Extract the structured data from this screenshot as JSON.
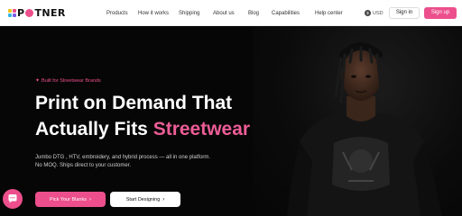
{
  "brand": {
    "logo_prefix": "P",
    "logo_suffix": "TNER",
    "logo_colors": [
      "#f0c21a",
      "#ec4f8c",
      "#37b6e6",
      "#7c5ce6"
    ],
    "o_color": "#ec4f8c"
  },
  "nav": {
    "links": [
      "Products",
      "How it works",
      "Shipping",
      "About us",
      "Blog",
      "Capabilities",
      "Help center"
    ],
    "currency_icon": "$",
    "currency": "USD",
    "signin_label": "Sign in",
    "signup_label": "Sign up"
  },
  "hero": {
    "badge_icon": "sparkle-icon",
    "badge_label": "Built for Streetwear Brands",
    "headline_line1": "Print on Demand That",
    "headline_line2_prefix": "Actually Fits ",
    "headline_accent": "Streetwear",
    "subtext_line1": "Jumbo DTG , HTV, embroidery, and hybrid process — all in one platform.",
    "subtext_line2": "No MOQ. Ships direct to your customer.",
    "primary_cta": "Pick Your Blanks",
    "secondary_cta": "Start Designing",
    "arrow_glyph": "›"
  },
  "colors": {
    "accent": "#ec4f8c",
    "accent_text": "#ec5d97",
    "hero_bg": "#060606"
  }
}
